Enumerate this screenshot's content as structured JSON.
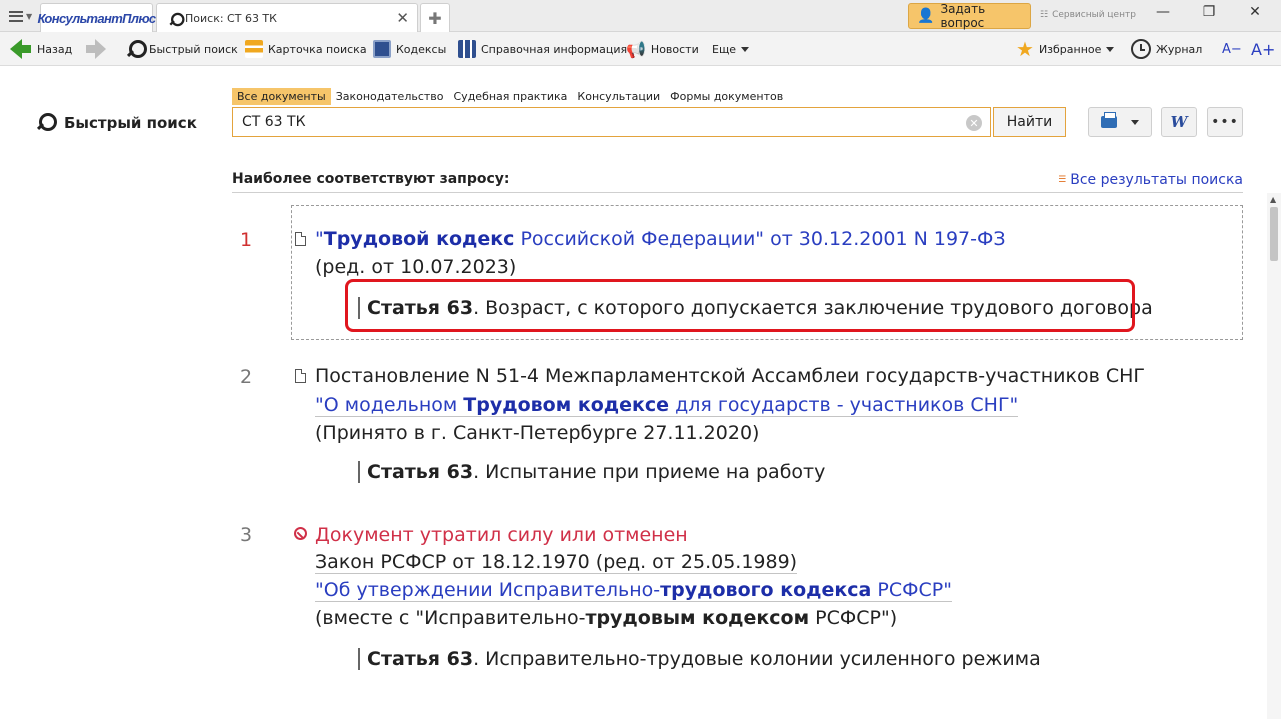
{
  "titlebar": {
    "brand": "КонсультантПлюс",
    "tab_title": "Поиск: СТ 63 ТК",
    "ask_button": "Задать вопрос",
    "service_center": "Сервисный центр"
  },
  "toolbar": {
    "back": "Назад",
    "quick_search": "Быстрый поиск",
    "search_card": "Карточка поиска",
    "codes": "Кодексы",
    "reference": "Справочная информация",
    "news": "Новости",
    "more": "Еще",
    "favorites": "Избранное",
    "journal": "Журнал",
    "font_smaller": "A−",
    "font_larger": "A+"
  },
  "search": {
    "title": "Быстрый поиск",
    "tabs": [
      "Все документы",
      "Законодательство",
      "Судебная практика",
      "Консультации",
      "Формы документов"
    ],
    "active_tab": 0,
    "query": "СТ 63 ТК",
    "find_button": "Найти"
  },
  "results": {
    "heading": "Наиболее соответствуют запросу:",
    "all_results": "Все результаты поиска",
    "items": [
      {
        "num": "1",
        "title_pre": "\"",
        "title_bold": "Трудовой кодекс",
        "title_post": " Российской Федерации\" от 30.12.2001 N 197-ФЗ",
        "edition": "(ред. от 10.07.2023)",
        "article_bold": "Статья 63",
        "article_text": ". Возраст, с которого допускается заключение трудового договора"
      },
      {
        "num": "2",
        "line1": "Постановление N 51-4 Межпарламентской Ассамблеи государств-участников СНГ",
        "link_pre": "\"О модельном ",
        "link_bold": "Трудовом кодексе",
        "link_post": " для государств - участников СНГ\"",
        "note": "(Принято в г. Санкт-Петербурге 27.11.2020)",
        "article_bold": "Статья 63",
        "article_text": ". Испытание при приеме на работу"
      },
      {
        "num": "3",
        "status": "Документ утратил силу или отменен",
        "line1": "Закон РСФСР от 18.12.1970 (ред. от 25.05.1989)",
        "link_pre": "\"Об утверждении Исправительно-",
        "link_bold": "трудового кодекса",
        "link_post": " РСФСР\"",
        "note_pre": "(вместе с \"Исправительно-",
        "note_bold": "трудовым кодексом",
        "note_post": " РСФСР\")",
        "article_bold": "Статья 63",
        "article_text": ". Исправительно-трудовые колонии усиленного режима"
      }
    ]
  },
  "colors": {
    "accent": "#f6c56a",
    "link": "#2a3ec0",
    "highlight": "#e0161e",
    "repealed": "#d03048"
  }
}
